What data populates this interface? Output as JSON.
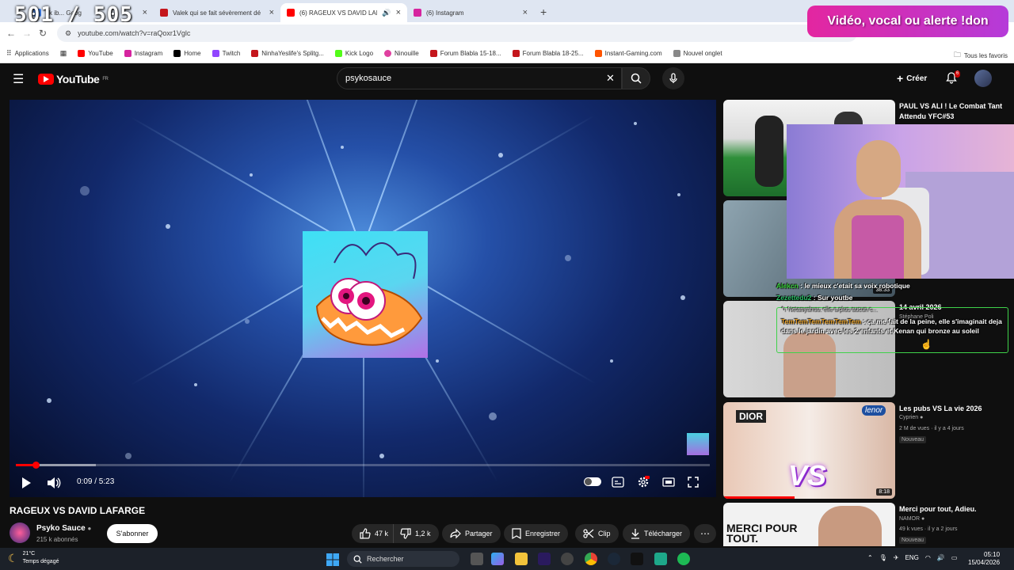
{
  "overlay": {
    "counter": "501 / 505",
    "donation": "Vidéo, vocal ou alerte !don"
  },
  "tabs": [
    {
      "title": "ck ib... Goog",
      "icon": "google-icon",
      "color": "#4285f4"
    },
    {
      "title": "Valek qui se fait sévèrement dé",
      "icon": "forum-icon",
      "color": "#c4161c"
    },
    {
      "title": "(6) RAGEUX VS DAVID LAFA",
      "icon": "youtube-icon",
      "color": "#ff0000"
    },
    {
      "title": "(6) Instagram",
      "icon": "instagram-icon",
      "color": "#d6249f"
    }
  ],
  "address": {
    "url": "youtube.com/watch?v=raQoxr1Vglc"
  },
  "bookmarks": [
    {
      "label": "Applications",
      "color": "#666"
    },
    {
      "label": "",
      "color": "#666"
    },
    {
      "label": "YouTube",
      "color": "#ff0000"
    },
    {
      "label": "Instagram",
      "color": "#d6249f"
    },
    {
      "label": "Home",
      "color": "#000"
    },
    {
      "label": "Twitch",
      "color": "#9146ff"
    },
    {
      "label": "NinhaYeslife's Splitg...",
      "color": "#c4161c"
    },
    {
      "label": "Kick Logo",
      "color": "#53fc18"
    },
    {
      "label": "Ninouille",
      "color": "#e040a0"
    },
    {
      "label": "Forum Blabla 15-18...",
      "color": "#c4161c"
    },
    {
      "label": "Forum Blabla 18-25...",
      "color": "#c4161c"
    },
    {
      "label": "Instant-Gaming.com",
      "color": "#ff5400"
    },
    {
      "label": "Nouvel onglet",
      "color": "#666"
    }
  ],
  "bookmarks_all": "Tous les favoris",
  "youtube": {
    "logo": "YouTube",
    "region": "FR",
    "search_value": "psykosauce",
    "create": "Créer",
    "notifications": "6"
  },
  "player": {
    "time": "0:09 / 5:23",
    "progress_fraction": 0.028,
    "buffered_fraction": 0.115
  },
  "video": {
    "title": "RAGEUX VS DAVID LAFARGE",
    "channel": "Psyko Sauce",
    "subscribers": "215 k abonnés",
    "subscribe": "S'abonner",
    "likes": "47 k",
    "dislikes": "1,2 k",
    "share": "Partager",
    "save": "Enregistrer",
    "clip": "Clip",
    "download": "Télécharger"
  },
  "sidebar": [
    {
      "title": "PAUL VS ALI ! Le Combat Tant Attendu YFC#53",
      "channel": "",
      "meta": "",
      "badge": "",
      "duration": ""
    },
    {
      "title": "",
      "channel": "",
      "meta": "",
      "badge": "",
      "duration": "38:33"
    },
    {
      "title": "14 avril 2026",
      "channel": "Stéphane Poli",
      "meta": "",
      "badge": "",
      "duration": ""
    },
    {
      "title": "Les pubs VS La vie 2026",
      "channel": "Cyprien",
      "meta": "2 M de vues · il y a 4 jours",
      "badge": "Nouveau",
      "duration": "8:18"
    },
    {
      "title": "Merci pour tout, Adieu.",
      "channel": "NAMOR",
      "meta": "49 k vues · il y a 2 jours",
      "badge": "Nouveau",
      "duration": ""
    }
  ],
  "thumbnail_text": {
    "merci": "MERCI POUR TOUT.",
    "vs": "VS",
    "dior": "DIOR",
    "lenor": "lenor"
  },
  "chat": [
    {
      "user": "Alekcn",
      "text": " : le mieux c'etait sa voix robotique",
      "color": "#39d23a"
    },
    {
      "user": "Zezettedu2",
      "text": " : Sur youtbe",
      "color": "#2dc46b"
    },
    {
      "user": "Netanyahuu",
      "text": ": elle a plus aucun c...",
      "color": "#ccc"
    },
    {
      "user": "TemTemTemTemTemTem",
      "text": " : ça me fait de la peine, elle s'imaginait deja dans le jardin avec les 2 enfants et Kenan qui bronze au soleil",
      "color": "#e9a22a"
    }
  ],
  "taskbar": {
    "temp": "21°C",
    "weather": "Temps dégagé",
    "search": "Rechercher",
    "lang": "ENG",
    "time": "05:10",
    "date": "15/04/2026"
  }
}
